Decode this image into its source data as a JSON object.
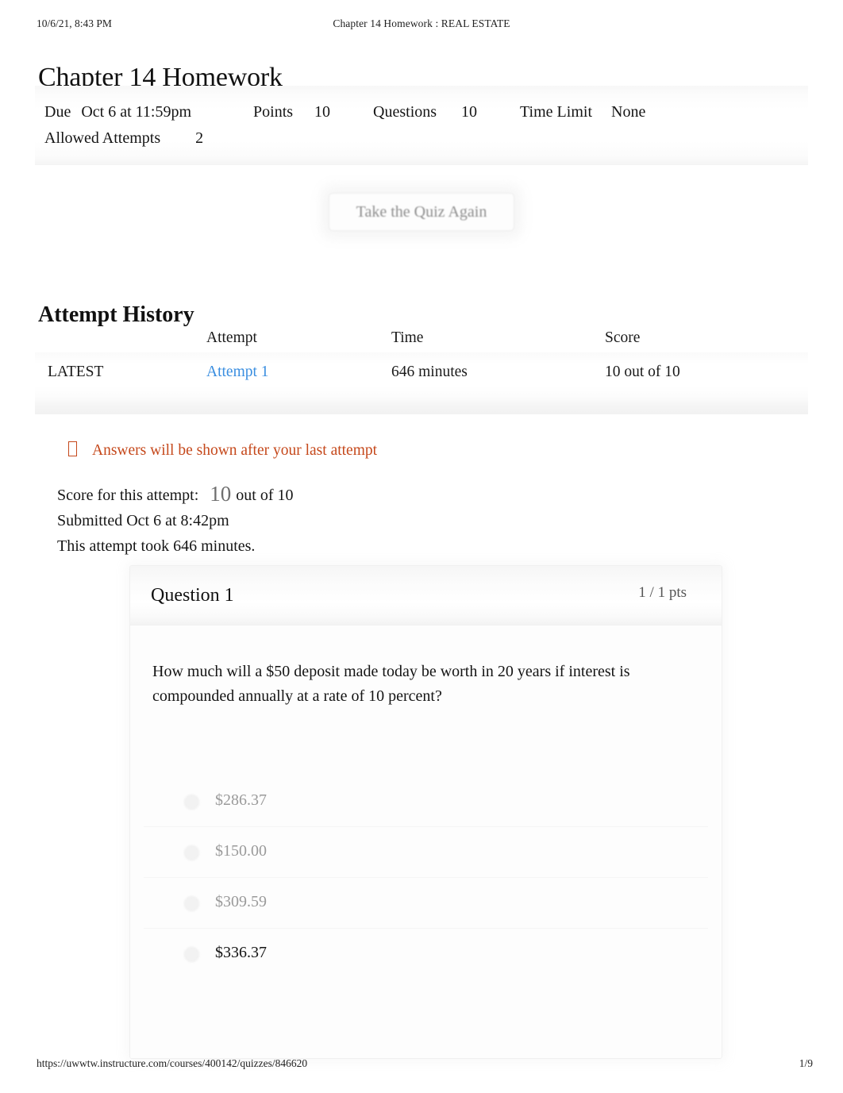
{
  "print_header": {
    "timestamp": "10/6/21, 8:43 PM",
    "document_title": "Chapter 14 Homework : REAL ESTATE"
  },
  "print_footer": {
    "url": "https://uwwtw.instructure.com/courses/400142/quizzes/846620",
    "page_number": "1/9"
  },
  "quiz": {
    "title": "Chapter 14 Homework",
    "meta": {
      "due_label": "Due",
      "due_value": "Oct 6 at 11:59pm",
      "points_label": "Points",
      "points_value": "10",
      "questions_label": "Questions",
      "questions_value": "10",
      "time_limit_label": "Time Limit",
      "time_limit_value": "None",
      "allowed_attempts_label": "Allowed Attempts",
      "allowed_attempts_value": "2"
    },
    "retake_button_label": "Take the Quiz Again"
  },
  "attempt_history": {
    "heading": "Attempt History",
    "columns": {
      "blank": "",
      "attempt": "Attempt",
      "time": "Time",
      "score": "Score"
    },
    "rows": [
      {
        "latest_badge": "LATEST",
        "attempt": "Attempt 1",
        "time": "646 minutes",
        "score": "10 out of 10"
      }
    ]
  },
  "notice": {
    "icon": "warning-box-icon",
    "text": "Answers will be shown after your last attempt",
    "color": "#c5481b"
  },
  "attempt_summary": {
    "score_label": "Score for this attempt:",
    "score_value": "10",
    "score_out_of": "out of 10",
    "submitted": "Submitted Oct 6 at 8:42pm",
    "duration": "This attempt took 646 minutes."
  },
  "question": {
    "title": "Question 1",
    "points": "1 / 1 pts",
    "text": "How much will a $50 deposit made today be worth in 20 years if interest is compounded annually at a rate of 10 percent?",
    "answers": [
      {
        "text": "$286.37",
        "selected": false
      },
      {
        "text": "$150.00",
        "selected": false
      },
      {
        "text": "$309.59",
        "selected": false
      },
      {
        "text": "$336.37",
        "selected": true
      }
    ]
  }
}
